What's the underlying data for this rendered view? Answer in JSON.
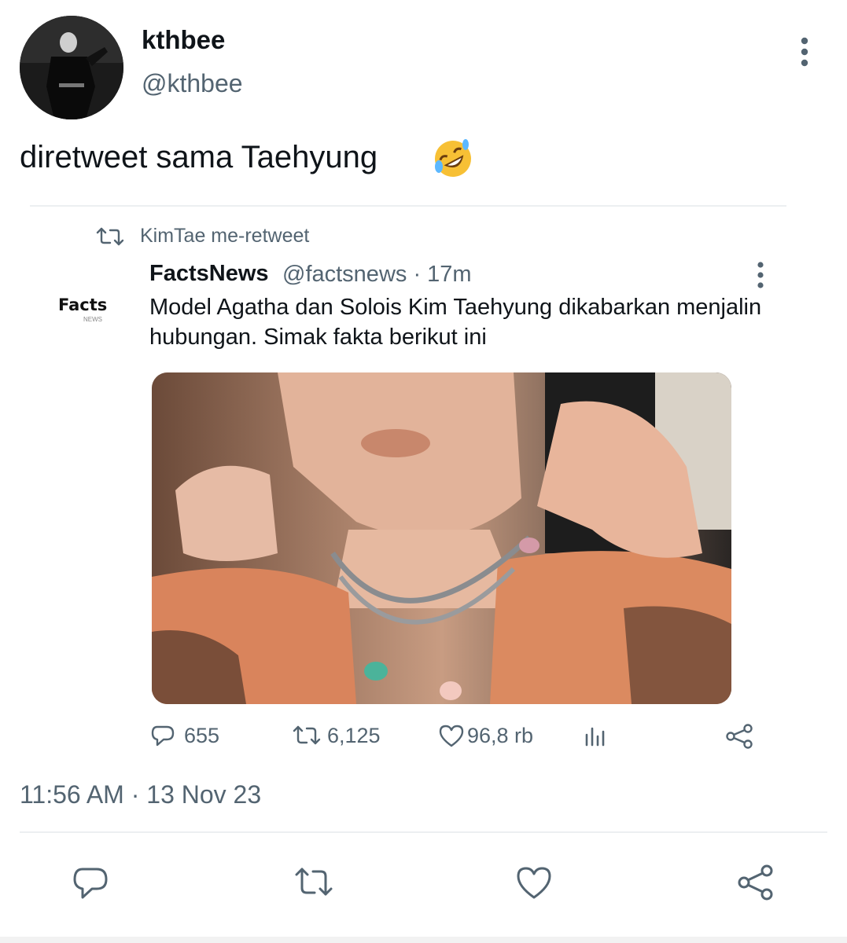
{
  "tweet": {
    "display_name": "kthbee",
    "handle": "@kthbee",
    "text": "diretweet sama Taehyung",
    "emoji": "rolling-on-floor-laughing-emoji",
    "timestamp": "11:56 AM · 13 Nov 23"
  },
  "quoted": {
    "retweet_label": "KimTae me-retweet",
    "logo_text": "Facts",
    "logo_subtext": "NEWS",
    "name": "FactsNews",
    "handle_time": "@factsnews · 17m",
    "body": "Model Agatha dan Solois Kim Taehyung dikabarkan menjalin hubungan. Simak fakta berikut ini",
    "replies": "655",
    "retweets": "6,125",
    "likes": "96,8 rb"
  },
  "icons": {
    "more": "more-vertical-icon",
    "reply": "reply-icon",
    "retweet": "retweet-icon",
    "like": "heart-icon",
    "views": "views-icon",
    "share": "share-icon"
  },
  "colors": {
    "text": "#0f1419",
    "secondary": "#536471",
    "divider": "#eceff1"
  }
}
